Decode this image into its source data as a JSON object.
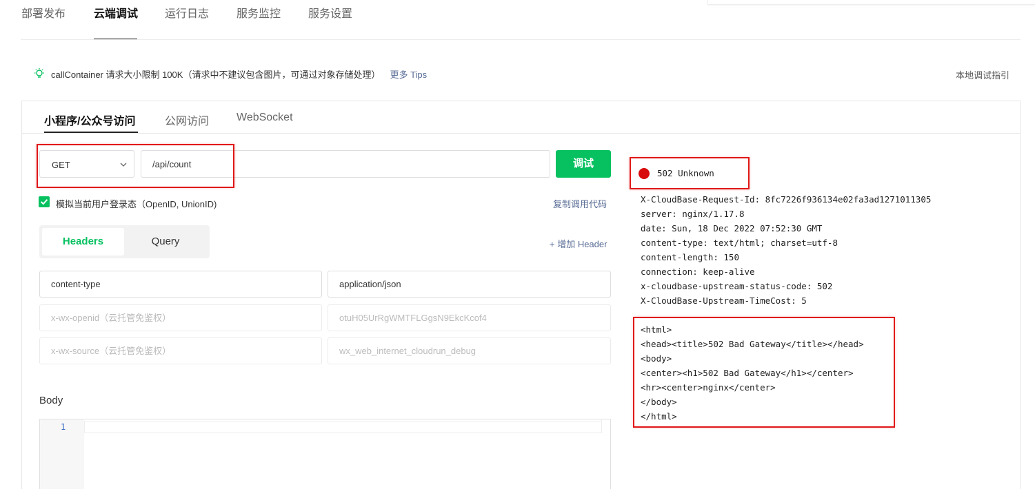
{
  "top_nav": {
    "tabs": [
      {
        "label": "部署发布",
        "active": false
      },
      {
        "label": "云端调试",
        "active": true
      },
      {
        "label": "运行日志",
        "active": false
      },
      {
        "label": "服务监控",
        "active": false
      },
      {
        "label": "服务设置",
        "active": false
      }
    ]
  },
  "tip": {
    "icon": "lightbulb-icon",
    "text": "callContainer 请求大小限制 100K（请求中不建议包含图片，可通过对象存储处理）",
    "link": "更多 Tips"
  },
  "local_guide": "本地调试指引",
  "sub_tabs": [
    {
      "label": "小程序/公众号访问",
      "active": true
    },
    {
      "label": "公网访问",
      "active": false
    },
    {
      "label": "WebSocket",
      "active": false
    }
  ],
  "request": {
    "method": "GET",
    "path": "/api/count",
    "debug_button": "调试",
    "simulate_login_label": "模拟当前用户登录态（OpenID, UnionID)",
    "simulate_login_checked": true,
    "copy_code_link": "复制调用代码"
  },
  "params": {
    "tabs": [
      {
        "label": "Headers",
        "active": true
      },
      {
        "label": "Query",
        "active": false
      }
    ],
    "add_header": "+ 增加 Header",
    "headers": [
      {
        "key": "content-type",
        "value": "application/json",
        "placeholder": false
      },
      {
        "key": "x-wx-openid（云托管免鉴权）",
        "value": "otuH05UrRgWMTFLGgsN9EkcKcof4",
        "placeholder": true
      },
      {
        "key": "x-wx-source（云托管免鉴权）",
        "value": "wx_web_internet_cloudrun_debug",
        "placeholder": true
      }
    ]
  },
  "body": {
    "label": "Body",
    "line_numbers": [
      "1"
    ]
  },
  "response": {
    "status": "502 Unknown",
    "status_color": "#d80c0c",
    "headers": [
      "X-CloudBase-Request-Id: 8fc7226f936134e02fa3ad1271011305",
      "server: nginx/1.17.8",
      "date: Sun, 18 Dec 2022 07:52:30 GMT",
      "content-type: text/html; charset=utf-8",
      "content-length: 150",
      "connection: keep-alive",
      "x-cloudbase-upstream-status-code: 502",
      "X-CloudBase-Upstream-TimeCost: 5"
    ],
    "body_lines": [
      "<html>",
      "<head><title>502 Bad Gateway</title></head>",
      "<body>",
      "<center><h1>502 Bad Gateway</h1></center>",
      "<hr><center>nginx</center>",
      "</body>",
      "</html>"
    ]
  },
  "colors": {
    "accent": "#07c160",
    "link": "#576b95",
    "highlight_box": "#e01818"
  }
}
